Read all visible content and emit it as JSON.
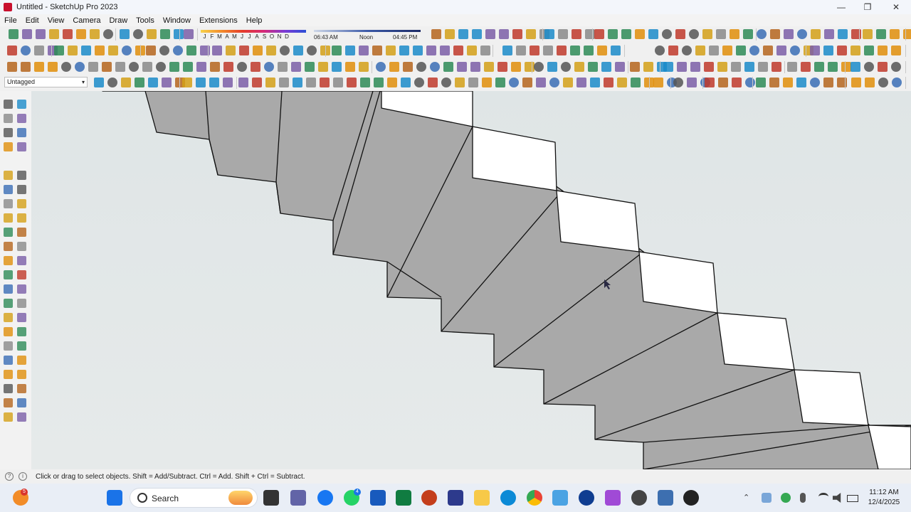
{
  "window": {
    "title": "Untitled - SketchUp Pro 2023",
    "minimize": "—",
    "maximize": "❐",
    "close": "✕"
  },
  "menu": [
    "File",
    "Edit",
    "View",
    "Camera",
    "Draw",
    "Tools",
    "Window",
    "Extensions",
    "Help"
  ],
  "shadow": {
    "months": [
      "J",
      "F",
      "M",
      "A",
      "M",
      "J",
      "J",
      "A",
      "S",
      "O",
      "N",
      "D"
    ],
    "time_start": "06:43 AM",
    "time_mid": "Noon",
    "time_end": "04:45 PM"
  },
  "tag": {
    "value": "Untagged"
  },
  "status": {
    "message": "Click or drag to select objects. Shift = Add/Subtract. Ctrl = Add. Shift + Ctrl = Subtract."
  },
  "taskbar": {
    "search_label": "Search",
    "time": "11:12 AM",
    "date": "12/4/2025",
    "start_badge": "5",
    "whatsapp_badge": "4"
  },
  "colors": {
    "face_top": "#ffffff",
    "face_side": "#a9a9a9",
    "edge": "#111111",
    "sketchup_red": "#c8102e",
    "viewport_bg": "#e2e7e8"
  }
}
